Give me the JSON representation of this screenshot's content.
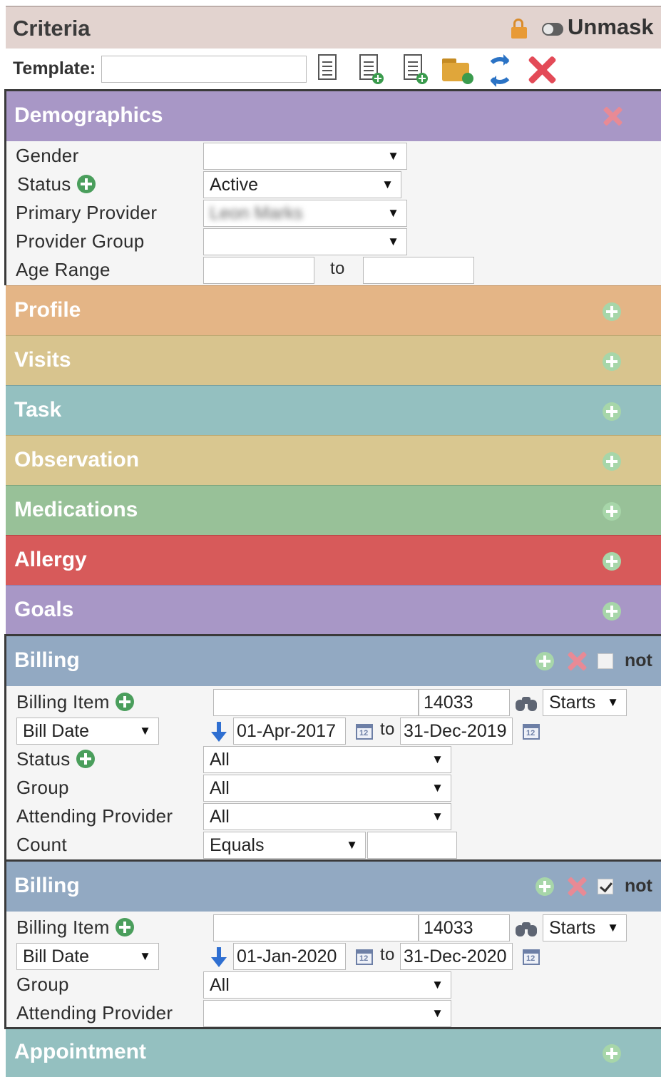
{
  "header": {
    "title": "Criteria",
    "unmask_label": "Unmask"
  },
  "template": {
    "label": "Template:",
    "value": "",
    "placeholder": ""
  },
  "demographics": {
    "title": "Demographics",
    "gender_label": "Gender",
    "gender_value": "",
    "status_label": "Status",
    "status_value": "Active",
    "primary_provider_label": "Primary Provider",
    "primary_provider_value": "Leon Marks",
    "provider_group_label": "Provider Group",
    "provider_group_value": "",
    "age_range_label": "Age Range",
    "age_to_label": "to",
    "age_from_value": "",
    "age_to_value": ""
  },
  "sections": {
    "profile": "Profile",
    "visits": "Visits",
    "task": "Task",
    "observation": "Observation",
    "medications": "Medications",
    "allergy": "Allergy",
    "goals": "Goals",
    "appointment": "Appointment"
  },
  "billing1": {
    "title": "Billing",
    "not_label": "not",
    "not_checked": false,
    "billing_item_label": "Billing Item",
    "billing_item_value": "",
    "code_value": "14033",
    "match_value": "Starts",
    "date_type_value": "Bill Date",
    "date_from": "01-Apr-2017",
    "to_label": "to",
    "date_to": "31-Dec-2019",
    "status_label": "Status",
    "status_value": "All",
    "group_label": "Group",
    "group_value": "All",
    "attending_label": "Attending Provider",
    "attending_value": "All",
    "count_label": "Count",
    "count_op_value": "Equals",
    "count_value": ""
  },
  "billing2": {
    "title": "Billing",
    "not_label": "not",
    "not_checked": true,
    "billing_item_label": "Billing Item",
    "billing_item_value": "",
    "code_value": "14033",
    "match_value": "Starts",
    "date_type_value": "Bill Date",
    "date_from": "01-Jan-2020",
    "to_label": "to",
    "date_to": "31-Dec-2020",
    "group_label": "Group",
    "group_value": "All",
    "attending_label": "Attending Provider",
    "attending_value": ""
  },
  "calendar_glyph": "12",
  "colors": {
    "header_bg": "#e2d3cf",
    "demographics": "#a897c6",
    "profile": "#e4b586",
    "visits": "#d8c48e",
    "task": "#94c0c0",
    "observation": "#d9c790",
    "medications": "#98c198",
    "allergy": "#d75a5a",
    "goals": "#a897c6",
    "billing": "#92a9c2",
    "appointment": "#94c0c0"
  }
}
